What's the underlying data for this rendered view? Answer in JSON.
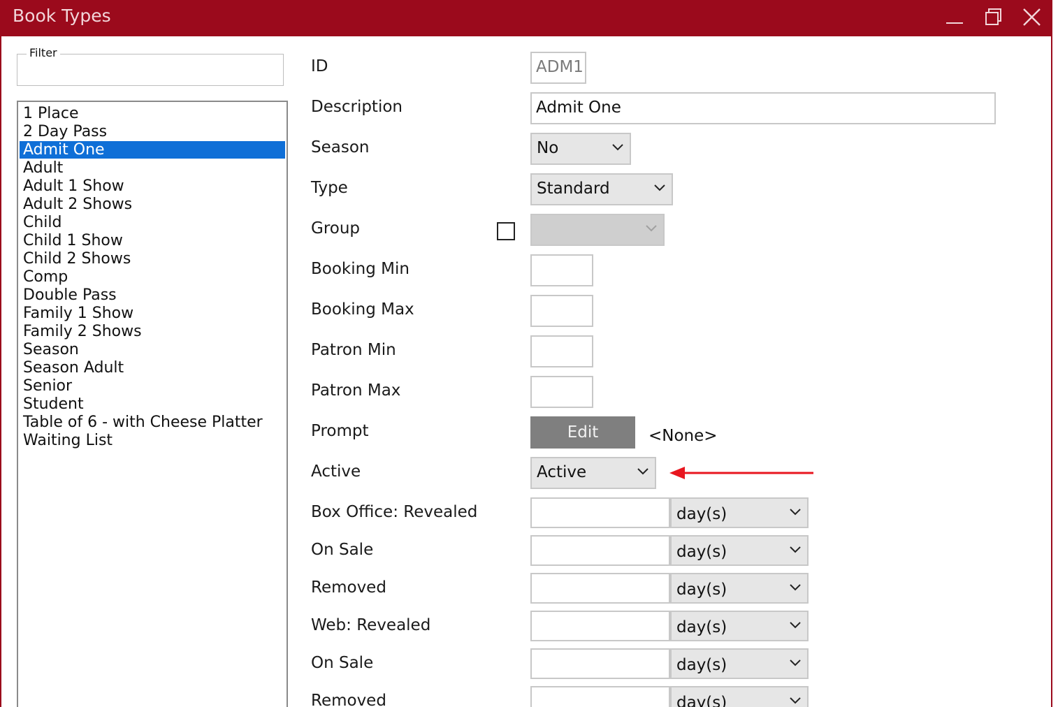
{
  "window": {
    "title": "Book Types",
    "accent_color": "#9b0a1c",
    "controls": [
      "minimize-icon",
      "maximize-icon",
      "close-icon"
    ]
  },
  "filter": {
    "legend": "Filter",
    "value": ""
  },
  "list": {
    "selected": "Admit One",
    "items": [
      "1 Place",
      "2 Day Pass",
      "Admit One",
      "Adult",
      "Adult 1 Show",
      "Adult 2 Shows",
      "Child",
      "Child 1 Show",
      "Child 2 Shows",
      "Comp",
      "Double Pass",
      "Family 1 Show",
      "Family 2 Shows",
      "Season",
      "Season Adult",
      "Senior",
      "Student",
      "Table of 6 - with Cheese Platter",
      "Waiting List"
    ]
  },
  "form": {
    "id": {
      "label": "ID",
      "value": "ADM1"
    },
    "description": {
      "label": "Description",
      "value": "Admit One"
    },
    "season": {
      "label": "Season",
      "value": "No"
    },
    "type": {
      "label": "Type",
      "value": "Standard"
    },
    "group": {
      "label": "Group",
      "checked": false,
      "value": ""
    },
    "booking_min": {
      "label": "Booking Min",
      "value": ""
    },
    "booking_max": {
      "label": "Booking Max",
      "value": ""
    },
    "patron_min": {
      "label": "Patron Min",
      "value": ""
    },
    "patron_max": {
      "label": "Patron Max",
      "value": ""
    },
    "prompt": {
      "label": "Prompt",
      "button": "Edit",
      "value": "<None>"
    },
    "active": {
      "label": "Active",
      "value": "Active"
    },
    "box_office_revealed": {
      "label": "Box Office: Revealed",
      "value": "",
      "unit": "day(s)"
    },
    "box_office_on_sale": {
      "label": "On Sale",
      "value": "",
      "unit": "day(s)"
    },
    "box_office_removed": {
      "label": "Removed",
      "value": "",
      "unit": "day(s)"
    },
    "web_revealed": {
      "label": "Web: Revealed",
      "value": "",
      "unit": "day(s)"
    },
    "web_on_sale": {
      "label": "On Sale",
      "value": "",
      "unit": "day(s)"
    },
    "web_removed": {
      "label": "Removed",
      "value": "",
      "unit": "day(s)"
    }
  },
  "annotation": {
    "arrow_color": "#e8161f"
  }
}
